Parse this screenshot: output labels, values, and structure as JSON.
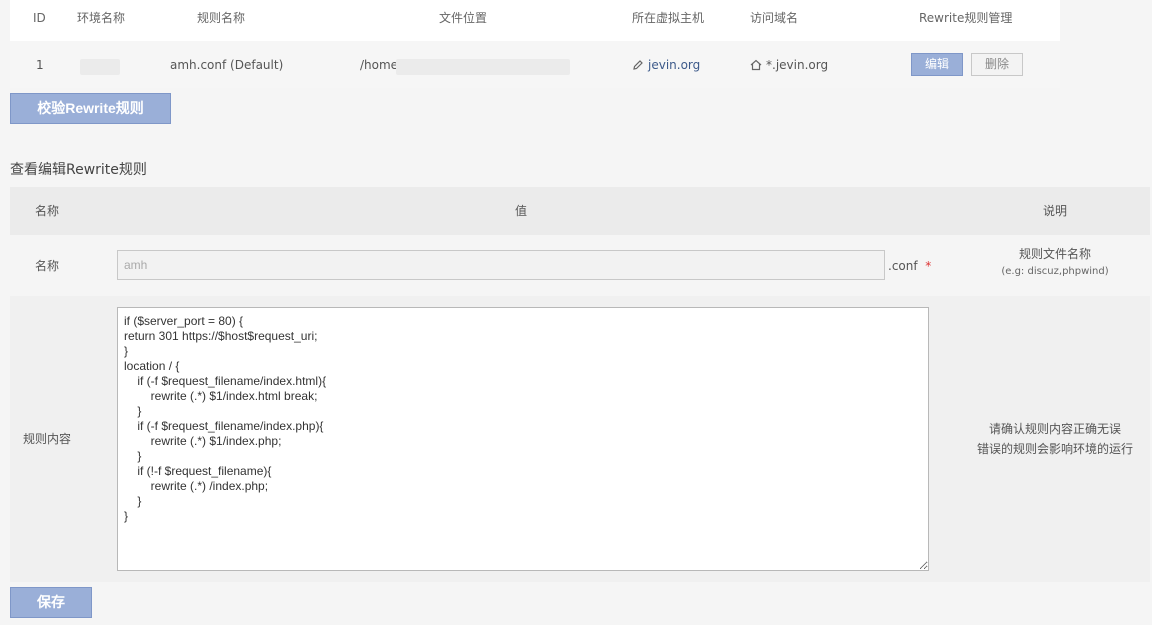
{
  "site_table": {
    "headers": [
      "ID",
      "环境名称",
      "规则名称",
      "文件位置",
      "所在虚拟主机",
      "访问域名",
      "Rewrite规则管理"
    ],
    "row": {
      "id": "1",
      "rule_name": "amh.conf  (Default)",
      "file_path": "/home/",
      "vhost": "jevin.org",
      "domain": "*.jevin.org",
      "edit_label": "编辑",
      "delete_label": "删除"
    }
  },
  "verify_button_label": "校验Rewrite规则",
  "section_title": "查看编辑Rewrite规则",
  "edit_table": {
    "headers": [
      "名称",
      "值",
      "说明"
    ],
    "name_row": {
      "label": "名称",
      "value": "amh",
      "suffix": ".conf",
      "required_mark": "*",
      "desc_line1": "规则文件名称",
      "desc_line2": "(e.g: discuz,phpwind)"
    },
    "content_row": {
      "label": "规则内容",
      "code": "if ($server_port = 80) {\nreturn 301 https://$host$request_uri;\n}\nlocation / {\n    if (-f $request_filename/index.html){\n        rewrite (.*) $1/index.html break;\n    }\n    if (-f $request_filename/index.php){\n        rewrite (.*) $1/index.php;\n    }\n    if (!-f $request_filename){\n        rewrite (.*) /index.php;\n    }\n}",
      "desc_line1": "请确认规则内容正确无误",
      "desc_line2": "错误的规则会影响环境的运行"
    }
  },
  "save_button_label": "保存"
}
